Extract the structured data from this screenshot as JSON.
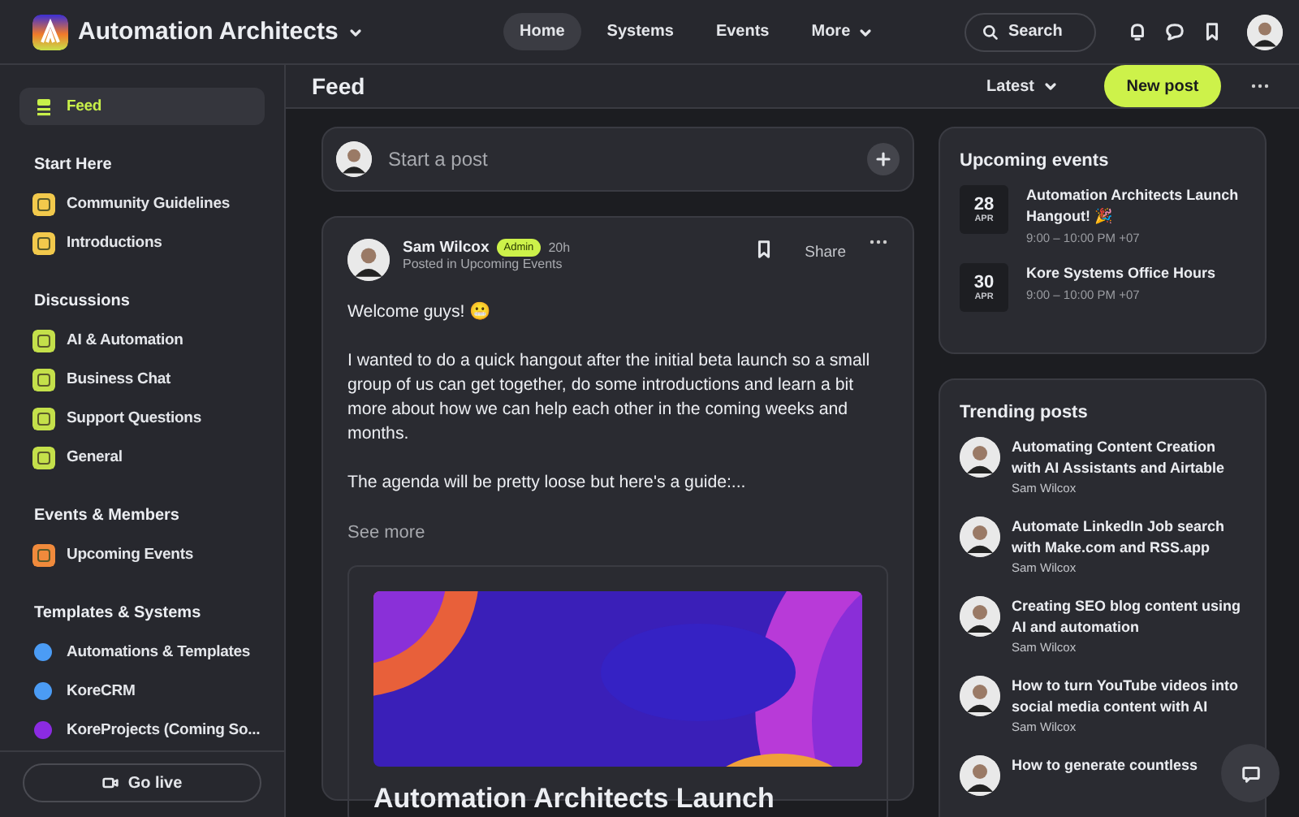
{
  "topbar": {
    "brand": "Automation Architects",
    "nav": [
      {
        "label": "Home",
        "selected": true
      },
      {
        "label": "Systems",
        "selected": false
      },
      {
        "label": "Events",
        "selected": false
      },
      {
        "label": "More",
        "selected": false,
        "dropdown": true
      }
    ],
    "search": {
      "placeholder": "Search"
    }
  },
  "sidebar": {
    "feed": {
      "label": "Feed",
      "selected": true
    },
    "sections": [
      {
        "title": "Start Here",
        "items": [
          {
            "label": "Community Guidelines",
            "kind": "icon",
            "color": "#f2c94c",
            "selected": false
          },
          {
            "label": "Introductions",
            "kind": "icon",
            "color": "#f2c94c",
            "selected": false
          }
        ]
      },
      {
        "title": "Discussions",
        "items": [
          {
            "label": "AI & Automation",
            "kind": "icon",
            "color": "#c4e04a",
            "selected": false
          },
          {
            "label": "Business Chat",
            "kind": "icon",
            "color": "#c4e04a",
            "selected": false
          },
          {
            "label": "Support Questions",
            "kind": "icon",
            "color": "#c4e04a",
            "selected": false
          },
          {
            "label": "General",
            "kind": "icon",
            "color": "#c4e04a",
            "selected": false
          }
        ]
      },
      {
        "title": "Events & Members",
        "items": [
          {
            "label": "Upcoming Events",
            "kind": "icon",
            "color": "#f08a3c",
            "selected": false
          }
        ]
      },
      {
        "title": "Templates & Systems",
        "items": [
          {
            "label": "Automations & Templates",
            "kind": "dot",
            "color": "#4b9cf5",
            "selected": false
          },
          {
            "label": "KoreCRM",
            "kind": "dot",
            "color": "#4b9cf5",
            "selected": false
          },
          {
            "label": "KoreProjects (Coming So...",
            "kind": "dot",
            "color": "#8b2be2",
            "selected": false
          }
        ]
      }
    ],
    "go_live": "Go live"
  },
  "header": {
    "title": "Feed",
    "sort": "Latest",
    "new_post": "New post"
  },
  "composer": {
    "placeholder": "Start a post"
  },
  "post": {
    "author": "Sam Wilcox",
    "badge": "Admin",
    "time": "20h",
    "posted_in": "Posted in Upcoming Events",
    "share": "Share",
    "paragraphs": [
      "Welcome guys! 😬",
      "I wanted to do a quick hangout after the initial beta launch so a small group of us can get together, do some introductions and learn a bit more about how we can help each other in the coming weeks and months.",
      "The agenda will be pretty loose but here's a guide:..."
    ],
    "see_more": "See more",
    "event_card": {
      "title": "Automation Architects Launch"
    }
  },
  "upcoming_events": {
    "title": "Upcoming events",
    "events": [
      {
        "day": "28",
        "month": "APR",
        "title": "Automation Architects Launch Hangout! 🎉",
        "time": "9:00 – 10:00 PM +07"
      },
      {
        "day": "30",
        "month": "APR",
        "title": "Kore Systems Office Hours",
        "time": "9:00 – 10:00 PM +07"
      }
    ]
  },
  "trending_posts": {
    "title": "Trending posts",
    "posts": [
      {
        "title": "Automating Content Creation with AI Assistants and Airtable",
        "author": "Sam Wilcox"
      },
      {
        "title": "Automate LinkedIn Job search with Make.com and RSS.app",
        "author": "Sam Wilcox"
      },
      {
        "title": "Creating SEO blog content using AI and automation",
        "author": "Sam Wilcox"
      },
      {
        "title": "How to turn YouTube videos into social media content with AI",
        "author": "Sam Wilcox"
      },
      {
        "title": "How to generate countless"
      }
    ]
  }
}
